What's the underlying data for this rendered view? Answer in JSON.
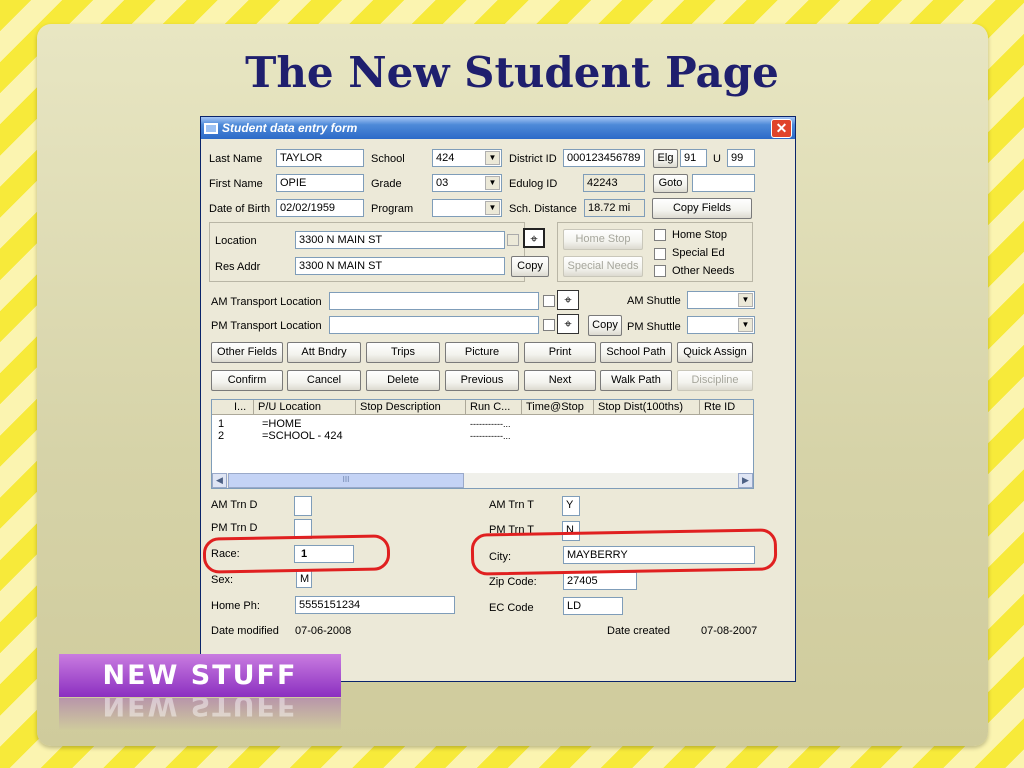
{
  "slide": {
    "title": "The New Student Page",
    "badge": "NEW STUFF"
  },
  "window": {
    "title": "Student data entry form",
    "close_glyph": "✕"
  },
  "fields": {
    "last_name": {
      "label": "Last Name",
      "value": "TAYLOR"
    },
    "first_name": {
      "label": "First Name",
      "value": "OPIE"
    },
    "dob": {
      "label": "Date of Birth",
      "value": "02/02/1959"
    },
    "school": {
      "label": "School",
      "value": "424"
    },
    "grade": {
      "label": "Grade",
      "value": "03"
    },
    "program": {
      "label": "Program",
      "value": ""
    },
    "district_id": {
      "label": "District ID",
      "value": "000123456789"
    },
    "edulog_id": {
      "label": "Edulog ID",
      "value": "42243"
    },
    "sch_distance": {
      "label": "Sch. Distance",
      "value": "18.72 mi"
    },
    "elg": {
      "label": "Elg",
      "value": "91"
    },
    "u": {
      "label": "U",
      "value": "99"
    },
    "goto_value": "",
    "location": {
      "label": "Location",
      "value": "3300 N MAIN ST"
    },
    "res_addr": {
      "label": "Res Addr",
      "value": "3300 N MAIN ST"
    },
    "am_transport": {
      "label": "AM Transport Location",
      "value": ""
    },
    "pm_transport": {
      "label": "PM Transport Location",
      "value": ""
    },
    "am_shuttle": {
      "label": "AM Shuttle",
      "value": ""
    },
    "pm_shuttle": {
      "label": "PM Shuttle",
      "value": ""
    }
  },
  "checkboxes": {
    "home_stop": "Home Stop",
    "special_ed": "Special Ed",
    "other_needs": "Other Needs"
  },
  "buttons": {
    "goto": "Goto",
    "copy_fields": "Copy Fields",
    "home_stop": "Home Stop",
    "special_needs": "Special Needs",
    "copy_res": "Copy",
    "copy_transport": "Copy",
    "other_fields": "Other Fields",
    "att_bndry": "Att Bndry",
    "trips": "Trips",
    "picture": "Picture",
    "print": "Print",
    "school_path": "School Path",
    "quick_assign": "Quick Assign",
    "confirm": "Confirm",
    "cancel": "Cancel",
    "delete": "Delete",
    "previous": "Previous",
    "next": "Next",
    "walk_path": "Walk Path",
    "discipline": "Discipline"
  },
  "stops_table": {
    "columns": [
      "I...",
      "P/U Location",
      "Stop Description",
      "Run C...",
      "Time@Stop",
      "Stop Dist(100ths)",
      "Rte ID"
    ],
    "rows": [
      {
        "index": "1",
        "location": "=HOME",
        "run": "-----------..."
      },
      {
        "index": "2",
        "location": "=SCHOOL - 424",
        "run": "-----------..."
      }
    ],
    "scroll_thumb": "III"
  },
  "bottom": {
    "am_trn_d": {
      "label": "AM Trn D",
      "value": ""
    },
    "pm_trn_d": {
      "label": "PM Trn D",
      "value": ""
    },
    "race": {
      "label": "Race:",
      "value": "1"
    },
    "sex": {
      "label": "Sex:",
      "value": "M"
    },
    "home_ph": {
      "label": "Home Ph:",
      "value": "5555151234"
    },
    "am_trn_t": {
      "label": "AM Trn T",
      "value": "Y"
    },
    "pm_trn_t": {
      "label": "PM Trn T",
      "value": "N"
    },
    "city": {
      "label": "City:",
      "value": "MAYBERRY"
    },
    "zip": {
      "label": "Zip Code:",
      "value": "27405"
    },
    "ec_code": {
      "label": "EC Code",
      "value": "LD"
    },
    "date_modified": {
      "label": "Date modified",
      "value": "07-06-2008"
    },
    "date_created": {
      "label": "Date created",
      "value": "07-08-2007"
    }
  },
  "colors": {
    "annotation": "#e02020",
    "title": "#1f1f6e",
    "badge": "#8b2fc0"
  },
  "icons": {
    "locate": "map-pin-icon",
    "close": "close-icon",
    "window": "window-icon"
  }
}
